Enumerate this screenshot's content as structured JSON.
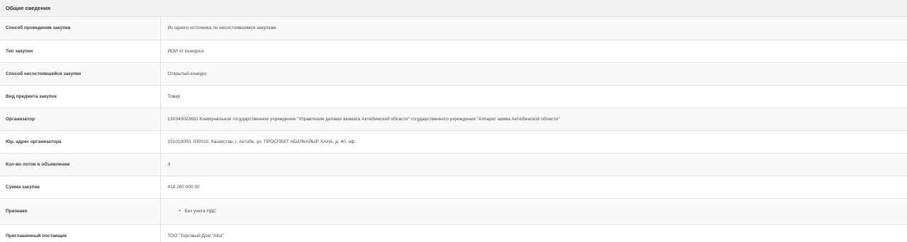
{
  "section": {
    "title": "Общие сведения"
  },
  "rows": {
    "method": {
      "label": "Способ проведения закупки",
      "value": "Из одного источника по несостоявшимся закупкам"
    },
    "type": {
      "label": "Тип закупки",
      "value": "ИОИ от конкурса"
    },
    "failed_method": {
      "label": "Способ несостоявшейся закупки",
      "value": "Открытый конкурс"
    },
    "subject": {
      "label": "Вид предмета закупок",
      "value": "Товар"
    },
    "organizer": {
      "label": "Организатор",
      "value": "130340022681 Коммунальное государственное учреждение \"Управление делами акимата Актюбинской области\" государственного учреждения \"Аппарат акима Актюбинской области\""
    },
    "address": {
      "label": "Юр. адрес организатора",
      "value": "151010000, 030010, Казахстан, г. Актобе, ул. ПРОСПЕКТ АБИЛКАЙЫР ХАНА, д. 40, оф."
    },
    "lots": {
      "label": "Кол-во лотов в объявлении",
      "value": "3"
    },
    "amount": {
      "label": "Сумма закупки",
      "value": "418 260 000.00"
    },
    "flags": {
      "label": "Признаки",
      "items": [
        "Без учета НДС"
      ]
    },
    "supplier": {
      "label": "Приглашенный поставщик",
      "value": "ТОО \"Торговый Дом \"Allur\""
    }
  }
}
